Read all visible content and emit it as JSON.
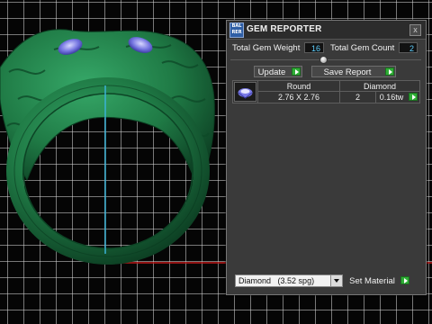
{
  "panel": {
    "title": "GEM REPORTER",
    "close_label": "x",
    "total_gem_weight_label": "Total Gem Weight",
    "total_gem_weight_value": "16",
    "total_gem_count_label": "Total Gem Count",
    "total_gem_count_value": "2",
    "update_label": "Update",
    "save_report_label": "Save Report",
    "gem_list": {
      "rows": [
        {
          "shape": "Round",
          "material": "Diamond",
          "size": "2.76 X 2.76",
          "count": "2",
          "weight": "0.16tw"
        }
      ]
    },
    "material_select": {
      "value": "Diamond",
      "spg": "(3.52 spg)"
    },
    "set_material_label": "Set Material"
  },
  "colors": {
    "ring": "#1f7a45",
    "gem": "#6f6fe0",
    "axis_vertical": "#3ab2d6",
    "axis_horizontal": "#c01818",
    "value_text": "#5fd0ff",
    "go_button": "#2fae36"
  },
  "icons": {
    "app_logo": "gem-reporter-logo-icon",
    "gem_thumbnail": "round-gem-icon",
    "go_arrow": "green-arrow-icon"
  }
}
